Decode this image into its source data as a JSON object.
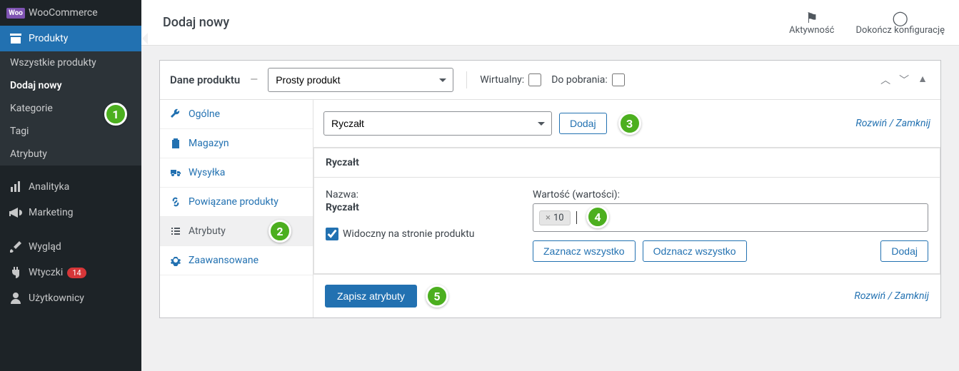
{
  "sidebar": {
    "woocommerce": "WooCommerce",
    "products": "Produkty",
    "sub": {
      "all": "Wszystkie produkty",
      "add": "Dodaj nowy",
      "cat": "Kategorie",
      "tags": "Tagi",
      "attr": "Atrybuty"
    },
    "analytics": "Analityka",
    "marketing": "Marketing",
    "appearance": "Wygląd",
    "plugins": "Wtyczki",
    "plugins_count": "14",
    "users": "Użytkownicy"
  },
  "header": {
    "title": "Dodaj nowy",
    "activity": "Aktywność",
    "finish": "Dokończ konfigurację"
  },
  "panel": {
    "title": "Dane produktu",
    "dash": "—",
    "product_type": "Prosty produkt",
    "virtual_label": "Wirtualny:",
    "downloadable_label": "Do pobrania:"
  },
  "vtabs": {
    "general": "Ogólne",
    "inventory": "Magazyn",
    "shipping": "Wysyłka",
    "linked": "Powiązane produkty",
    "attributes": "Atrybuty",
    "advanced": "Zaawansowane"
  },
  "attr": {
    "select_value": "Ryczałt",
    "add_btn": "Dodaj",
    "expand": "Rozwiń / Zamknij",
    "box_title": "Ryczałt",
    "name_label": "Nazwa:",
    "name_value": "Ryczałt",
    "visible_label": "Widoczny na stronie produktu",
    "values_label": "Wartość (wartości):",
    "tag_value": "10",
    "select_all": "Zaznacz wszystko",
    "deselect_all": "Odznacz wszystko",
    "add_value": "Dodaj",
    "save": "Zapisz atrybuty"
  },
  "badges": {
    "b1": "1",
    "b2": "2",
    "b3": "3",
    "b4": "4",
    "b5": "5"
  }
}
